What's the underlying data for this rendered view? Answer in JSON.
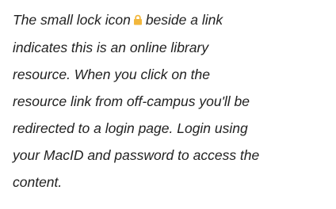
{
  "note": {
    "line1_before_icon": "The small lock icon",
    "line1_after_icon": "beside a link",
    "lines": [
      "indicates this is an online library",
      "resource.  When you click on the",
      "resource link from off-campus you'll be",
      "redirected to a login page. Login using",
      "your MacID and password to access the",
      "content."
    ],
    "icon": "lock-icon",
    "icon_color": "#F2B73C"
  }
}
